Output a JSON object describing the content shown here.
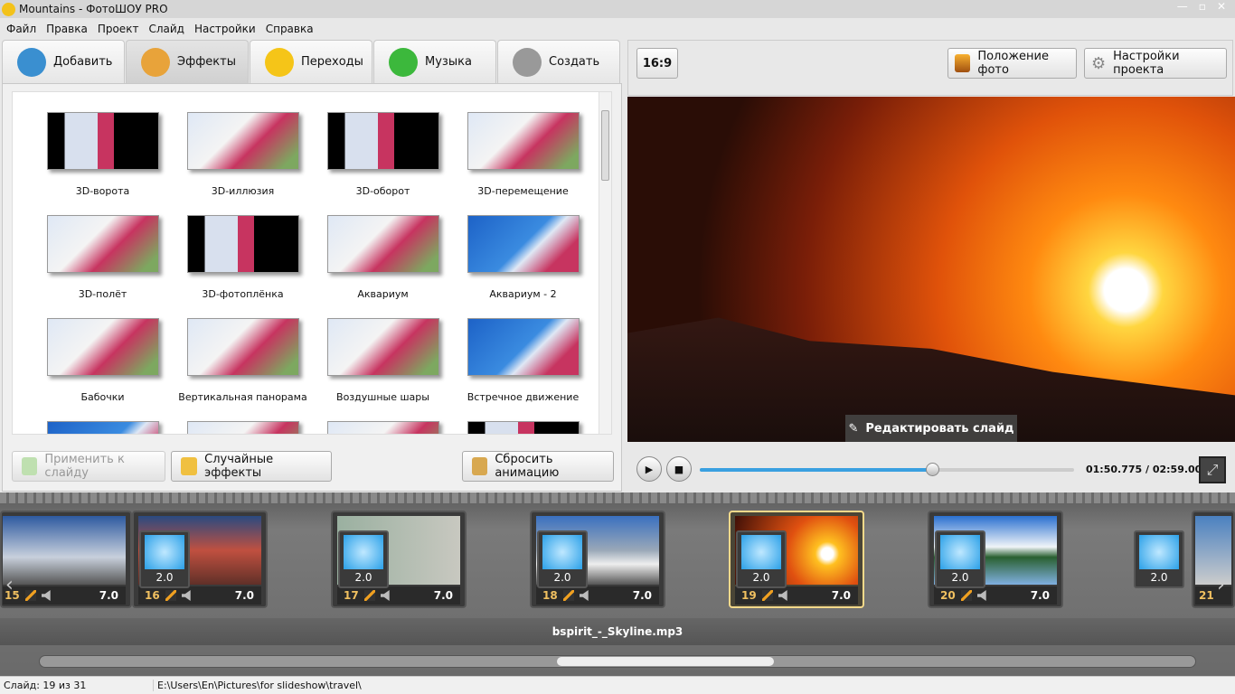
{
  "window": {
    "title": "Mountains - ФотоШОУ PRO"
  },
  "menu": [
    "Файл",
    "Правка",
    "Проект",
    "Слайд",
    "Настройки",
    "Справка"
  ],
  "tabs": [
    {
      "label": "Добавить",
      "icon": "camera-icon",
      "color": "#3a8fd0"
    },
    {
      "label": "Эффекты",
      "icon": "palette-icon",
      "color": "#e8a33a",
      "active": true
    },
    {
      "label": "Переходы",
      "icon": "star-icon",
      "color": "#f5c518"
    },
    {
      "label": "Музыка",
      "icon": "music-note-icon",
      "color": "#3cb83c"
    },
    {
      "label": "Создать",
      "icon": "film-reel-icon",
      "color": "#999999"
    }
  ],
  "effects": {
    "items": [
      {
        "label": "3D-ворота",
        "style": "dark"
      },
      {
        "label": "3D-иллюзия",
        "style": ""
      },
      {
        "label": "3D-оборот",
        "style": "dark"
      },
      {
        "label": "3D-перемещение",
        "style": ""
      },
      {
        "label": "3D-полёт",
        "style": ""
      },
      {
        "label": "3D-фотоплёнка",
        "style": "dark"
      },
      {
        "label": "Аквариум",
        "style": ""
      },
      {
        "label": "Аквариум - 2",
        "style": "blue"
      },
      {
        "label": "Бабочки",
        "style": ""
      },
      {
        "label": "Вертикальная панорама",
        "style": ""
      },
      {
        "label": "Воздушные шары",
        "style": ""
      },
      {
        "label": "Встречное движение",
        "style": "blue"
      },
      {
        "label": "",
        "style": "blue"
      },
      {
        "label": "",
        "style": ""
      },
      {
        "label": "",
        "style": ""
      },
      {
        "label": "",
        "style": "dark"
      }
    ],
    "apply_label": "Применить к слайду",
    "random_label": "Случайные эффекты",
    "reset_label": "Сбросить анимацию"
  },
  "toolbar": {
    "aspect": "16:9",
    "photo_position": "Положение фото",
    "project_settings": "Настройки проекта"
  },
  "preview": {
    "edit_slide": "Редактировать слайд"
  },
  "player": {
    "time": "01:50.775 / 02:59.000",
    "progress": 0.62
  },
  "timeline": {
    "slides": [
      {
        "num": "15",
        "duration": "7.0",
        "gradient": "linear-gradient(#2e5aa0,#c8d0dc 60%,#555)"
      },
      {
        "num": "16",
        "duration": "7.0",
        "gradient": "linear-gradient(#2a4a80,#c05040 50%,#603028)"
      },
      {
        "num": "17",
        "duration": "7.0",
        "gradient": "linear-gradient(90deg,#9ab0a0,#c8c8c0)"
      },
      {
        "num": "18",
        "duration": "7.0",
        "gradient": "linear-gradient(#3a70c0,#9aa8b8 50%,#eee 70%,#555)"
      },
      {
        "num": "19",
        "duration": "7.0",
        "gradient": "radial-gradient(circle at 75% 55%,#fff 0 6%,#ffc020 12%,#e05010 40%,#401008)",
        "selected": true
      },
      {
        "num": "20",
        "duration": "7.0",
        "gradient": "linear-gradient(#2a70d0,#f0f4f8 45%,#2a6030 60%,#80b0e0)"
      },
      {
        "num": "21",
        "duration": "",
        "gradient": "linear-gradient(#4a80c0,#ccc)"
      }
    ],
    "transitions": [
      "2.0",
      "2.0",
      "2.0",
      "2.0",
      "2.0",
      "2.0"
    ],
    "audio": "bspirit_-_Skyline.mp3"
  },
  "status": {
    "slide": "Слайд: 19 из 31",
    "path": "E:\\Users\\En\\Pictures\\for slideshow\\travel\\"
  }
}
